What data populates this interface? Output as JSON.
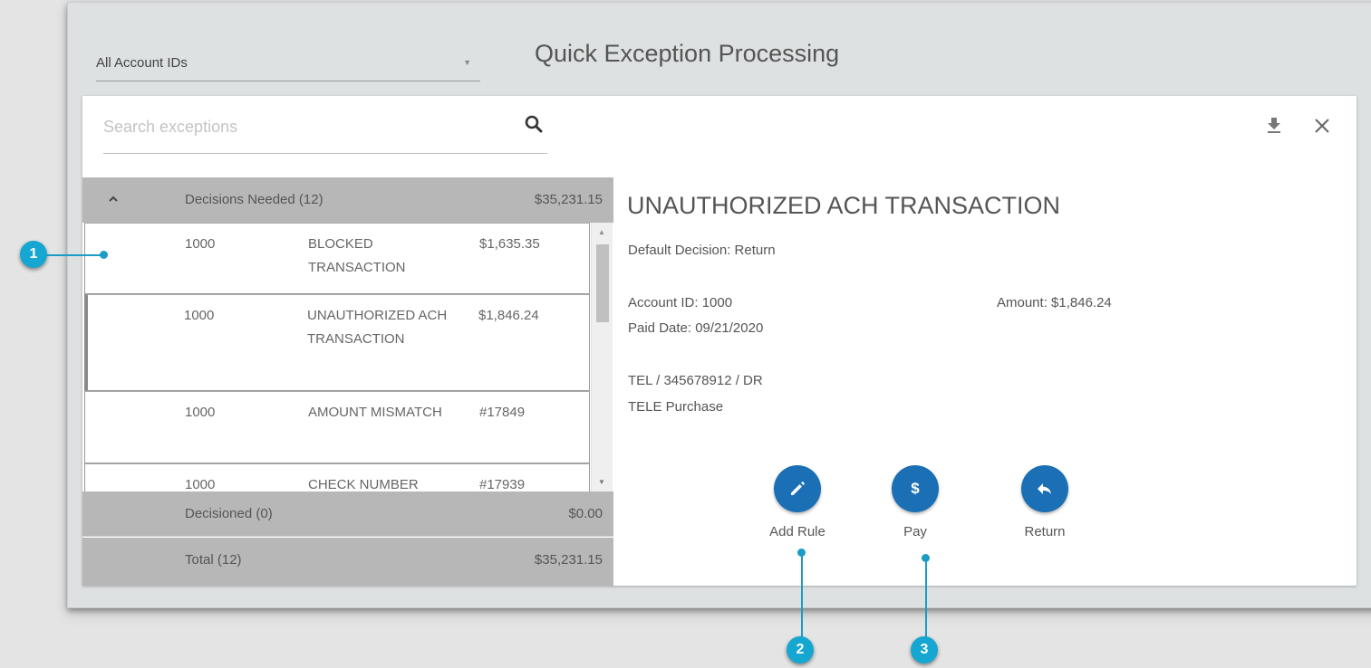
{
  "header": {
    "account_select": "All Account IDs",
    "title": "Quick Exception Processing"
  },
  "search": {
    "placeholder": "Search exceptions"
  },
  "icons": {
    "search": "search-icon",
    "download": "download-icon",
    "close": "close-icon",
    "collapse": "chevron-up-icon"
  },
  "groups": {
    "decisions_needed": {
      "label": "Decisions Needed (12)",
      "amount": "$35,231.15"
    },
    "decisioned": {
      "label": "Decisioned (0)",
      "amount": "$0.00"
    },
    "total": {
      "label": "Total (12)",
      "amount": "$35,231.15"
    }
  },
  "rows": [
    {
      "account": "1000",
      "type": "BLOCKED TRANSACTION",
      "value": "$1,635.35"
    },
    {
      "account": "1000",
      "type": "UNAUTHORIZED ACH TRANSACTION",
      "value": "$1,846.24"
    },
    {
      "account": "1000",
      "type": "AMOUNT MISMATCH",
      "value": "#17849"
    },
    {
      "account": "1000",
      "type": "CHECK NUMBER",
      "value": "#17939"
    }
  ],
  "detail": {
    "title": "UNAUTHORIZED ACH TRANSACTION",
    "default_decision": "Default Decision:  Return",
    "account_id": "Account ID:  1000",
    "amount": "Amount:  $1,846.24",
    "paid_date": "Paid Date:  09/21/2020",
    "desc1": "TEL / 345678912 / DR",
    "desc2": "TELE Purchase"
  },
  "actions": {
    "add_rule": "Add Rule",
    "pay": "Pay",
    "pay_symbol": "$",
    "return": "Return"
  },
  "callouts": {
    "c1": "1",
    "c2": "2",
    "c3": "3"
  },
  "colors": {
    "accent": "#1a6fb5",
    "callout": "#15a7d1"
  }
}
